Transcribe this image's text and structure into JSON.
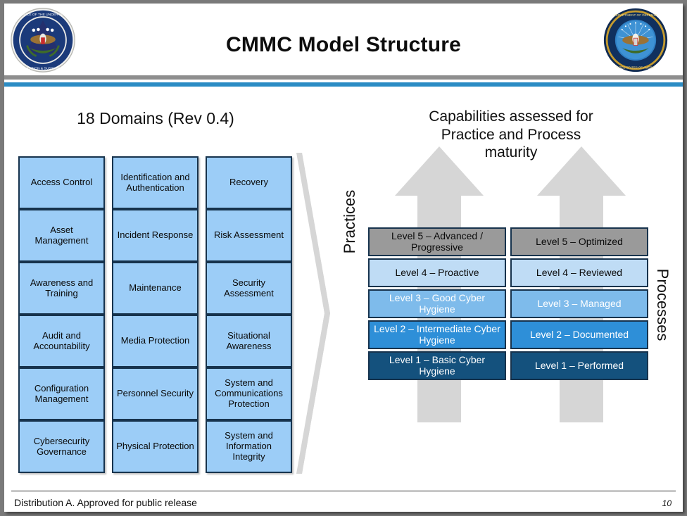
{
  "header": {
    "title": "CMMC Model Structure",
    "left_seal_name": "ousd-acquisition-sustainment-seal",
    "right_seal_name": "department-of-defense-seal",
    "rule_gray": "#8e8e8e",
    "rule_blue": "#2b8cc4"
  },
  "left_panel": {
    "heading": "18 Domains (Rev 0.4)",
    "domains": [
      "Access Control",
      "Identification and Authentication",
      "Recovery",
      "Asset Management",
      "Incident Response",
      "Risk Assessment",
      "Awareness and Training",
      "Maintenance",
      "Security Assessment",
      "Audit and Accountability",
      "Media Protection",
      "Situational Awareness",
      "Configuration Management",
      "Personnel Security",
      "System and Communications Protection",
      "Cybersecurity Governance",
      "Physical Protection",
      "System and Information Integrity"
    ],
    "box_fill": "#9ccdf7",
    "box_border": "#17334d"
  },
  "right_panel": {
    "heading": "Capabilities assessed for Practice and Process maturity",
    "heading_lines": [
      "Capabilities assessed for",
      "Practice and Process",
      "maturity"
    ],
    "axis_label_left": "Practices",
    "axis_label_right": "Processes",
    "arrow_color": "#d4d4d4",
    "practices": [
      {
        "label": "Level 5 – Advanced / Progressive",
        "tier": "lv5",
        "fill": "#9a9a9a",
        "text_color": "#0a0a0a"
      },
      {
        "label": "Level 4 – Proactive",
        "tier": "lv4",
        "fill": "#bfdcf5",
        "text_color": "#0a0a0a"
      },
      {
        "label": "Level 3 – Good Cyber Hygiene",
        "tier": "lv3",
        "fill": "#7ebbeb",
        "text_color": "#ffffff"
      },
      {
        "label": "Level 2 – Intermediate Cyber Hygiene",
        "tier": "lv2",
        "fill": "#2e8fd8",
        "text_color": "#ffffff"
      },
      {
        "label": "Level 1 – Basic Cyber Hygiene",
        "tier": "lv1",
        "fill": "#14517d",
        "text_color": "#ffffff"
      }
    ],
    "processes": [
      {
        "label": "Level 5 – Optimized",
        "tier": "lv5",
        "fill": "#9a9a9a",
        "text_color": "#0a0a0a"
      },
      {
        "label": "Level 4 – Reviewed",
        "tier": "lv4",
        "fill": "#bfdcf5",
        "text_color": "#0a0a0a"
      },
      {
        "label": "Level 3 – Managed",
        "tier": "lv3",
        "fill": "#7ebbeb",
        "text_color": "#ffffff"
      },
      {
        "label": "Level 2 – Documented",
        "tier": "lv2",
        "fill": "#2e8fd8",
        "text_color": "#ffffff"
      },
      {
        "label": "Level 1 – Performed",
        "tier": "lv1",
        "fill": "#14517d",
        "text_color": "#ffffff"
      }
    ]
  },
  "footer": {
    "distribution": "Distribution A.  Approved for public release",
    "page_number": "10"
  }
}
